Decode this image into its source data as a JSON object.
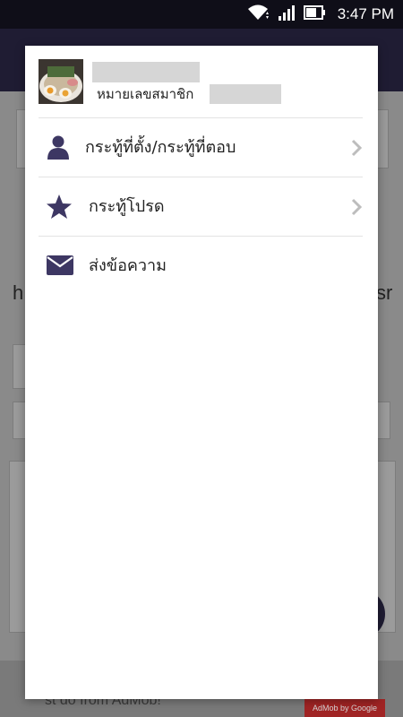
{
  "status_bar": {
    "time": "3:47 PM",
    "icons": [
      "wifi-icon",
      "signal-icon",
      "battery-icon"
    ]
  },
  "background": {
    "left_fragment": "h",
    "right_fragment": "sr",
    "ad_text": "st do from AdMob!",
    "ad_badge": "AdMob by Google"
  },
  "profile": {
    "name": "",
    "member_label": "หมายเลขสมาชิก",
    "member_id": ""
  },
  "menu": {
    "items": [
      {
        "label": "กระทู้ที่ตั้ง/กระทู้ที่ตอบ",
        "icon": "person-icon",
        "has_chevron": true
      },
      {
        "label": "กระทู้โปรด",
        "icon": "star-icon",
        "has_chevron": true
      },
      {
        "label": "ส่งข้อความ",
        "icon": "mail-icon",
        "has_chevron": false
      }
    ]
  },
  "colors": {
    "icon": "#3d3763",
    "chevron": "#bdbdbd",
    "status_bar": "#0f0e18"
  }
}
